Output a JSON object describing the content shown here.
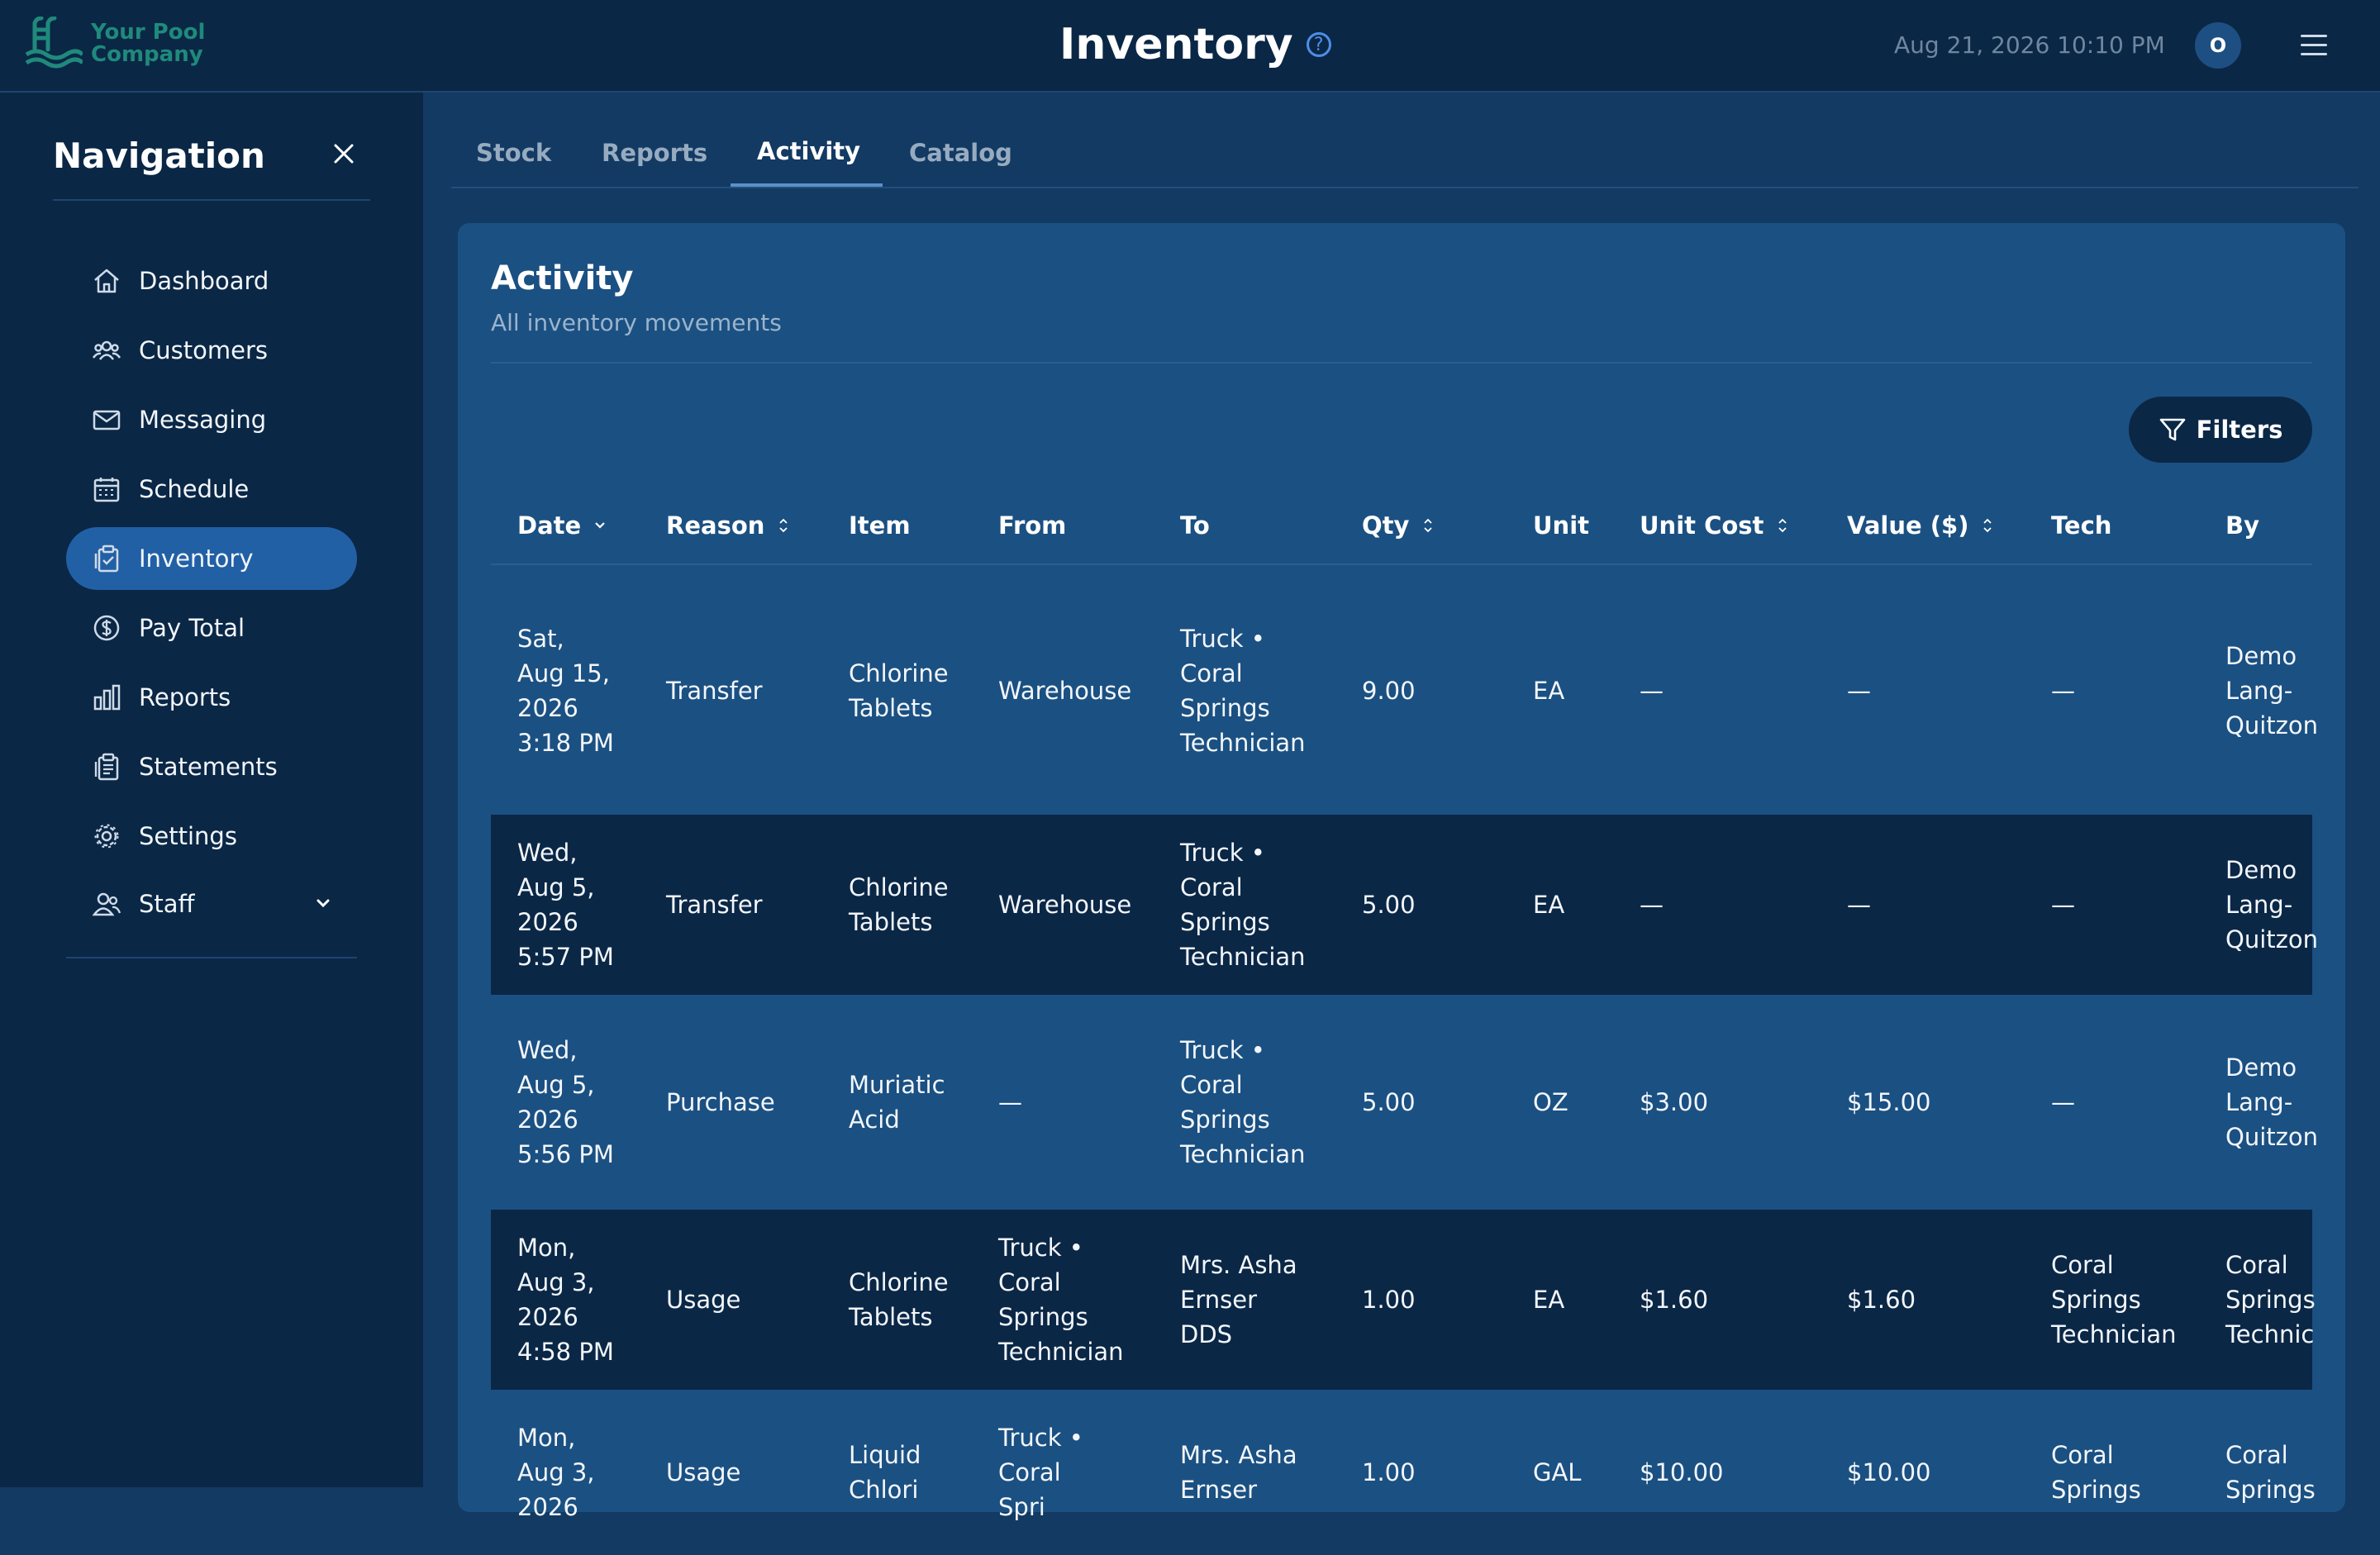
{
  "header": {
    "logo_line1": "Your Pool",
    "logo_line2": "Company",
    "title": "Inventory",
    "help_glyph": "?",
    "datetime": "Aug 21, 2026 10:10 PM",
    "avatar_initial": "O"
  },
  "sidebar": {
    "title": "Navigation",
    "items": [
      {
        "label": "Dashboard",
        "icon": "home-icon"
      },
      {
        "label": "Customers",
        "icon": "users-icon"
      },
      {
        "label": "Messaging",
        "icon": "mail-icon"
      },
      {
        "label": "Schedule",
        "icon": "calendar-icon"
      },
      {
        "label": "Inventory",
        "icon": "clipboard-icon",
        "active": true
      },
      {
        "label": "Pay Total",
        "icon": "dollar-icon"
      },
      {
        "label": "Reports",
        "icon": "bar-chart-icon"
      },
      {
        "label": "Statements",
        "icon": "document-icon"
      },
      {
        "label": "Settings",
        "icon": "gear-icon"
      },
      {
        "label": "Staff",
        "icon": "staff-icon"
      }
    ]
  },
  "tabs": [
    {
      "label": "Stock"
    },
    {
      "label": "Reports"
    },
    {
      "label": "Activity",
      "active": true
    },
    {
      "label": "Catalog"
    }
  ],
  "card": {
    "title": "Activity",
    "subtitle": "All inventory movements",
    "filters_label": "Filters"
  },
  "table": {
    "columns": [
      "Date",
      "Reason",
      "Item",
      "From",
      "To",
      "Qty",
      "Unit",
      "Unit Cost",
      "Value ($)",
      "Tech",
      "By"
    ],
    "rows": [
      {
        "date": [
          "Sat,",
          "Aug 15,",
          "2026",
          "3:18 PM"
        ],
        "reason": [
          "Transfer"
        ],
        "item": [
          "Chlorine",
          "Tablets"
        ],
        "from": [
          "Warehouse"
        ],
        "to": [
          "Truck •",
          "Coral",
          "Springs",
          "Technician"
        ],
        "qty": [
          "9.00"
        ],
        "unit": [
          "EA"
        ],
        "unit_cost": [
          "—"
        ],
        "value": [
          "—"
        ],
        "tech": [
          "—"
        ],
        "by": [
          "Demo",
          "Lang-",
          "Quitzon"
        ]
      },
      {
        "date": [
          "Wed,",
          "Aug 5,",
          "2026",
          "5:57 PM"
        ],
        "reason": [
          "Transfer"
        ],
        "item": [
          "Chlorine",
          "Tablets"
        ],
        "from": [
          "Warehouse"
        ],
        "to": [
          "Truck •",
          "Coral",
          "Springs",
          "Technician"
        ],
        "qty": [
          "5.00"
        ],
        "unit": [
          "EA"
        ],
        "unit_cost": [
          "—"
        ],
        "value": [
          "—"
        ],
        "tech": [
          "—"
        ],
        "by": [
          "Demo",
          "Lang-",
          "Quitzon"
        ]
      },
      {
        "date": [
          "Wed,",
          "Aug 5,",
          "2026",
          "5:56 PM"
        ],
        "reason": [
          "Purchase"
        ],
        "item": [
          "Muriatic",
          "Acid"
        ],
        "from": [
          "—"
        ],
        "to": [
          "Truck •",
          "Coral",
          "Springs",
          "Technician"
        ],
        "qty": [
          "5.00"
        ],
        "unit": [
          "OZ"
        ],
        "unit_cost": [
          "$3.00"
        ],
        "value": [
          "$15.00"
        ],
        "tech": [
          "—"
        ],
        "by": [
          "Demo",
          "Lang-",
          "Quitzon"
        ]
      },
      {
        "date": [
          "Mon,",
          "Aug 3,",
          "2026",
          "4:58 PM"
        ],
        "reason": [
          "Usage"
        ],
        "item": [
          "Chlorine",
          "Tablets"
        ],
        "from": [
          "Truck •",
          "Coral",
          "Springs",
          "Technician"
        ],
        "to": [
          "Mrs. Asha",
          "Ernser",
          "DDS"
        ],
        "qty": [
          "1.00"
        ],
        "unit": [
          "EA"
        ],
        "unit_cost": [
          "$1.60"
        ],
        "value": [
          "$1.60"
        ],
        "tech": [
          "Coral",
          "Springs",
          "Technician"
        ],
        "by": [
          "Coral",
          "Springs",
          "Technic"
        ]
      },
      {
        "date": [
          "Mon,",
          "Aug 3,",
          "2026"
        ],
        "reason": [
          "Usage"
        ],
        "item": [
          "Liquid",
          "Chlori"
        ],
        "from": [
          "Truck •",
          "Coral",
          "Spri"
        ],
        "to": [
          "Mrs. Asha",
          "Ernser"
        ],
        "qty": [
          "1.00"
        ],
        "unit": [
          "GAL"
        ],
        "unit_cost": [
          "$10.00"
        ],
        "value": [
          "$10.00"
        ],
        "tech": [
          "Coral",
          "Springs"
        ],
        "by": [
          "Coral",
          "Springs"
        ]
      }
    ]
  }
}
